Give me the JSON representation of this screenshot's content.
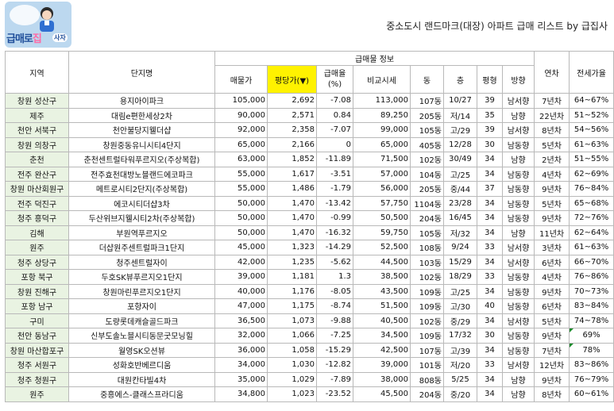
{
  "logo": {
    "text": "급매로",
    "text_highlight": "집",
    "tag": "사자"
  },
  "title": "중소도시 랜드마크(대장) 아파트 급매 리스트 by 급집사",
  "table": {
    "group_header": "급매물 정보",
    "headers": {
      "region": "지역",
      "complex": "단지명",
      "price": "매물가",
      "price_per_pyeong": "평당가(▼)",
      "discount": "급매율\n(%)",
      "comparable": "비교시세",
      "building": "동",
      "floor": "층",
      "pyeong": "평형",
      "direction": "방향",
      "age": "연차",
      "jeonse_ratio": "전세가율"
    },
    "rows": [
      {
        "region": "창원 성산구",
        "complex": "용지아이파크",
        "price": "105,000",
        "ppp": "2,692",
        "discount": "-7.08",
        "comparable": "113,000",
        "building": "107동",
        "floor": "10/27",
        "pyeong": "39",
        "direction": "남서향",
        "age": "7년차",
        "jeonse": "64~67%"
      },
      {
        "region": "제주",
        "complex": "대림e편한세상2차",
        "price": "90,000",
        "ppp": "2,571",
        "discount": "0.84",
        "comparable": "89,250",
        "building": "205동",
        "floor": "저/14",
        "pyeong": "35",
        "direction": "남향",
        "age": "22년차",
        "jeonse": "51~52%"
      },
      {
        "region": "천안 서북구",
        "complex": "천안불당지웰더샵",
        "price": "92,000",
        "ppp": "2,358",
        "discount": "-7.07",
        "comparable": "99,000",
        "building": "105동",
        "floor": "고/29",
        "pyeong": "39",
        "direction": "남서향",
        "age": "8년차",
        "jeonse": "54~56%"
      },
      {
        "region": "창원 의창구",
        "complex": "창원중동유니시티4단지",
        "price": "65,000",
        "ppp": "2,166",
        "discount": "0",
        "comparable": "65,000",
        "building": "405동",
        "floor": "12/28",
        "pyeong": "30",
        "direction": "남동향",
        "age": "5년차",
        "jeonse": "61~63%"
      },
      {
        "region": "춘천",
        "complex": "춘천센트럴타워푸르지오(주상복합)",
        "price": "63,000",
        "ppp": "1,852",
        "discount": "-11.89",
        "comparable": "71,500",
        "building": "102동",
        "floor": "30/49",
        "pyeong": "34",
        "direction": "남향",
        "age": "2년차",
        "jeonse": "51~55%"
      },
      {
        "region": "전주 완산구",
        "complex": "전주효천대방노블랜드에코파크",
        "price": "55,000",
        "ppp": "1,617",
        "discount": "-3.51",
        "comparable": "57,000",
        "building": "104동",
        "floor": "고/25",
        "pyeong": "34",
        "direction": "남동향",
        "age": "4년차",
        "jeonse": "62~69%"
      },
      {
        "region": "창원 마산회원구",
        "complex": "메트로시티2단지(주상복합)",
        "price": "55,000",
        "ppp": "1,486",
        "discount": "-1.79",
        "comparable": "56,000",
        "building": "205동",
        "floor": "중/44",
        "pyeong": "37",
        "direction": "남동향",
        "age": "9년차",
        "jeonse": "76~84%"
      },
      {
        "region": "전주 덕진구",
        "complex": "에코시티더샵3차",
        "price": "50,000",
        "ppp": "1,470",
        "discount": "-13.42",
        "comparable": "57,750",
        "building": "1104동",
        "floor": "23/28",
        "pyeong": "34",
        "direction": "남동향",
        "age": "5년차",
        "jeonse": "65~68%"
      },
      {
        "region": "청주 흥덕구",
        "complex": "두산위브지웰시티2차(주상복합)",
        "price": "50,000",
        "ppp": "1,470",
        "discount": "-0.99",
        "comparable": "50,500",
        "building": "204동",
        "floor": "16/45",
        "pyeong": "34",
        "direction": "남동향",
        "age": "9년차",
        "jeonse": "72~76%"
      },
      {
        "region": "김해",
        "complex": "부원역푸르지오",
        "price": "50,000",
        "ppp": "1,470",
        "discount": "-16.32",
        "comparable": "59,750",
        "building": "105동",
        "floor": "저/32",
        "pyeong": "34",
        "direction": "남향",
        "age": "11년차",
        "jeonse": "62~64%"
      },
      {
        "region": "원주",
        "complex": "더샵원주센트럴파크1단지",
        "price": "45,000",
        "ppp": "1,323",
        "discount": "-14.29",
        "comparable": "52,500",
        "building": "108동",
        "floor": "9/24",
        "pyeong": "33",
        "direction": "남서향",
        "age": "3년차",
        "jeonse": "61~63%"
      },
      {
        "region": "청주 상당구",
        "complex": "청주센트럴자이",
        "price": "42,000",
        "ppp": "1,235",
        "discount": "-5.62",
        "comparable": "44,500",
        "building": "103동",
        "floor": "15/29",
        "pyeong": "34",
        "direction": "남서향",
        "age": "6년차",
        "jeonse": "66~70%"
      },
      {
        "region": "포항 북구",
        "complex": "두호SK뷰푸르지오1단지",
        "price": "39,000",
        "ppp": "1,181",
        "discount": "1.3",
        "comparable": "38,500",
        "building": "102동",
        "floor": "18/29",
        "pyeong": "33",
        "direction": "남동향",
        "age": "4년차",
        "jeonse": "76~86%"
      },
      {
        "region": "창원 진해구",
        "complex": "창원마린푸르지오1단지",
        "price": "40,000",
        "ppp": "1,176",
        "discount": "-8.05",
        "comparable": "43,500",
        "building": "109동",
        "floor": "고/25",
        "pyeong": "34",
        "direction": "남동향",
        "age": "9년차",
        "jeonse": "70~73%"
      },
      {
        "region": "포항 남구",
        "complex": "포항자이",
        "price": "47,000",
        "ppp": "1,175",
        "discount": "-8.74",
        "comparable": "51,500",
        "building": "109동",
        "floor": "고/30",
        "pyeong": "40",
        "direction": "남동향",
        "age": "6년차",
        "jeonse": "83~84%"
      },
      {
        "region": "구미",
        "complex": "도량롯데캐슬골드파크",
        "price": "36,500",
        "ppp": "1,073",
        "discount": "-9.88",
        "comparable": "40,500",
        "building": "102동",
        "floor": "중/29",
        "pyeong": "34",
        "direction": "남서향",
        "age": "5년차",
        "jeonse": "74~78%"
      },
      {
        "region": "천안 동남구",
        "complex": "신부도솔노블시티동문굿모닝힐",
        "price": "32,000",
        "ppp": "1,066",
        "discount": "-7.25",
        "comparable": "34,500",
        "building": "109동",
        "floor": "17/32",
        "pyeong": "30",
        "direction": "남동향",
        "age": "9년차",
        "jeonse": "69%"
      },
      {
        "region": "창원 마산합포구",
        "complex": "월영SK오션뷰",
        "price": "36,000",
        "ppp": "1,058",
        "discount": "-15.29",
        "comparable": "42,500",
        "building": "107동",
        "floor": "고/39",
        "pyeong": "34",
        "direction": "남동향",
        "age": "7년차",
        "jeonse": "78%"
      },
      {
        "region": "청주 서원구",
        "complex": "성화호반베르디움",
        "price": "34,000",
        "ppp": "1,030",
        "discount": "-12.82",
        "comparable": "39,000",
        "building": "101동",
        "floor": "저/20",
        "pyeong": "33",
        "direction": "남서향",
        "age": "12년차",
        "jeonse": "83~86%"
      },
      {
        "region": "청주 청원구",
        "complex": "대원칸타빌4차",
        "price": "35,000",
        "ppp": "1,029",
        "discount": "-7.89",
        "comparable": "38,000",
        "building": "808동",
        "floor": "5/25",
        "pyeong": "34",
        "direction": "남향",
        "age": "9년차",
        "jeonse": "76~79%"
      },
      {
        "region": "원주",
        "complex": "중흥에스-클래스프라디움",
        "price": "34,800",
        "ppp": "1,023",
        "discount": "-23.52",
        "comparable": "45,500",
        "building": "204동",
        "floor": "중/20",
        "pyeong": "34",
        "direction": "남향",
        "age": "8년차",
        "jeonse": "60~61%"
      }
    ]
  }
}
